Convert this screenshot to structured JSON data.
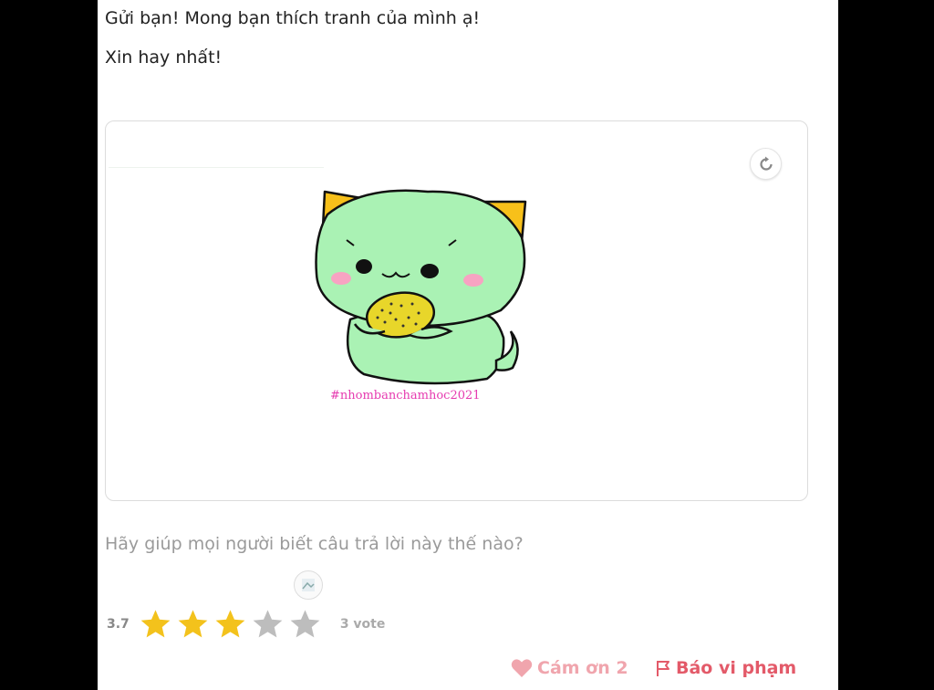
{
  "answer": {
    "line1": "Gửi bạn! Mong bạn thích tranh của mình ạ!",
    "line2": "Xin hay nhất!"
  },
  "image": {
    "watermark": "#nhombanchamhoc2021",
    "body_color": "#aaf2b4",
    "ear_color": "#f7c01a",
    "lemon_color": "#e8d62a",
    "cheek_color": "#f7a3c2"
  },
  "feedback": {
    "question": "Hãy giúp mọi người biết câu trả lời này thế nào?"
  },
  "rating": {
    "score": "3.7",
    "filled_stars": 3,
    "total_stars": 5,
    "votes": "3 vote",
    "star_color": "#f3c21c",
    "empty_color": "#bdbdbd"
  },
  "actions": {
    "thanks_label": "Cám ơn 2",
    "report_label": "Báo vi phạm"
  },
  "icons": {
    "rotate": "rotate-icon",
    "heart": "heart-icon",
    "flag": "flag-icon",
    "star": "star-icon",
    "avatar": "avatar-icon"
  }
}
